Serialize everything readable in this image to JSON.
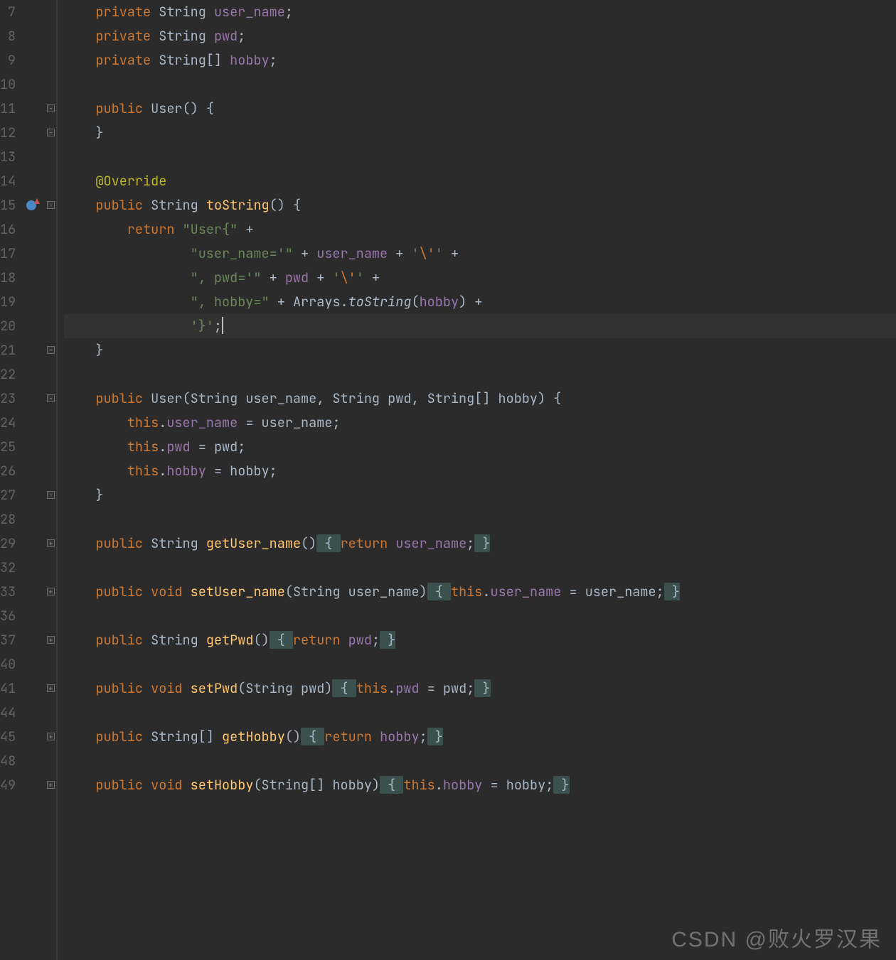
{
  "lineNumbers": [
    "7",
    "8",
    "9",
    "10",
    "11",
    "12",
    "13",
    "14",
    "15",
    "16",
    "17",
    "18",
    "19",
    "20",
    "21",
    "22",
    "23",
    "24",
    "25",
    "26",
    "27",
    "28",
    "29",
    "32",
    "33",
    "36",
    "37",
    "40",
    "41",
    "44",
    "45",
    "48",
    "49"
  ],
  "folds": {
    "11": "open-down",
    "12": "close-up",
    "15": "open-down",
    "21": "close-up",
    "23": "open-down",
    "27": "close-up",
    "29": "plus",
    "33": "plus",
    "37": "plus",
    "41": "plus",
    "45": "plus",
    "49": "plus"
  },
  "gutterIcons": {
    "15": "override"
  },
  "currentLine": "20",
  "watermark": "CSDN @败火罗汉果",
  "code": {
    "l7": {
      "kw": "private",
      "type": "String",
      "field": "user_name",
      "end": ";"
    },
    "l8": {
      "kw": "private",
      "type": "String",
      "field": "pwd",
      "end": ";"
    },
    "l9": {
      "kw": "private",
      "type": "String[]",
      "field": "hobby",
      "end": ";"
    },
    "l11": {
      "kw": "public",
      "name": "User",
      "sig": "() {"
    },
    "l12": {
      "text": "}"
    },
    "l14": {
      "ann": "@Override"
    },
    "l15": {
      "kw": "public",
      "type": "String",
      "method": "toString",
      "sig": "() {"
    },
    "l16": {
      "kw": "return ",
      "str": "\"User{\"",
      "op": " +"
    },
    "l17": {
      "str1": "\"user_name='\"",
      "op1": " + ",
      "field": "user_name",
      "op2": " + ",
      "ch1": "'",
      "esc": "\\'",
      "ch2": "'",
      "op3": " +"
    },
    "l18": {
      "str1": "\", pwd='\"",
      "op1": " + ",
      "field": "pwd",
      "op2": " + ",
      "ch1": "'",
      "esc": "\\'",
      "ch2": "'",
      "op3": " +"
    },
    "l19": {
      "str1": "\", hobby=\"",
      "op1": " + ",
      "cls": "Arrays",
      "dot": ".",
      "call": "toString",
      "lp": "(",
      "field": "hobby",
      "rp": ")",
      "op2": " +"
    },
    "l20": {
      "ch1": "'}'",
      "end": ";"
    },
    "l21": {
      "text": "}"
    },
    "l23": {
      "kw": "public",
      "name": "User",
      "sig": "(String user_name, String pwd, String[] hobby) {"
    },
    "l24": {
      "this": "this",
      "dot": ".",
      "field": "user_name",
      "eq": " = ",
      "param": "user_name",
      "end": ";"
    },
    "l25": {
      "this": "this",
      "dot": ".",
      "field": "pwd",
      "eq": " = ",
      "param": "pwd",
      "end": ";"
    },
    "l26": {
      "this": "this",
      "dot": ".",
      "field": "hobby",
      "eq": " = ",
      "param": "hobby",
      "end": ";"
    },
    "l27": {
      "text": "}"
    },
    "l29": {
      "kw": "public",
      "type": "String",
      "method": "getUser_name",
      "sig": "()",
      "bo": " { ",
      "ret": "return ",
      "field": "user_name",
      "sc": ";",
      "bc": " }"
    },
    "l33": {
      "kw": "public",
      "type": "void",
      "method": "setUser_name",
      "sig": "(String user_name)",
      "bo": " { ",
      "this": "this",
      "dot": ".",
      "field": "user_name",
      "eq": " = ",
      "param": "user_name",
      "sc": ";",
      "bc": " }"
    },
    "l37": {
      "kw": "public",
      "type": "String",
      "method": "getPwd",
      "sig": "()",
      "bo": " { ",
      "ret": "return ",
      "field": "pwd",
      "sc": ";",
      "bc": " }"
    },
    "l41": {
      "kw": "public",
      "type": "void",
      "method": "setPwd",
      "sig": "(String pwd)",
      "bo": " { ",
      "this": "this",
      "dot": ".",
      "field": "pwd",
      "eq": " = ",
      "param": "pwd",
      "sc": ";",
      "bc": " }"
    },
    "l45": {
      "kw": "public",
      "type": "String[]",
      "method": "getHobby",
      "sig": "()",
      "bo": " { ",
      "ret": "return ",
      "field": "hobby",
      "sc": ";",
      "bc": " }"
    },
    "l49": {
      "kw": "public",
      "type": "void",
      "method": "setHobby",
      "sig": "(String[] hobby)",
      "bo": " { ",
      "this": "this",
      "dot": ".",
      "field": "hobby",
      "eq": " = ",
      "param": "hobby",
      "sc": ";",
      "bc": " }"
    }
  }
}
